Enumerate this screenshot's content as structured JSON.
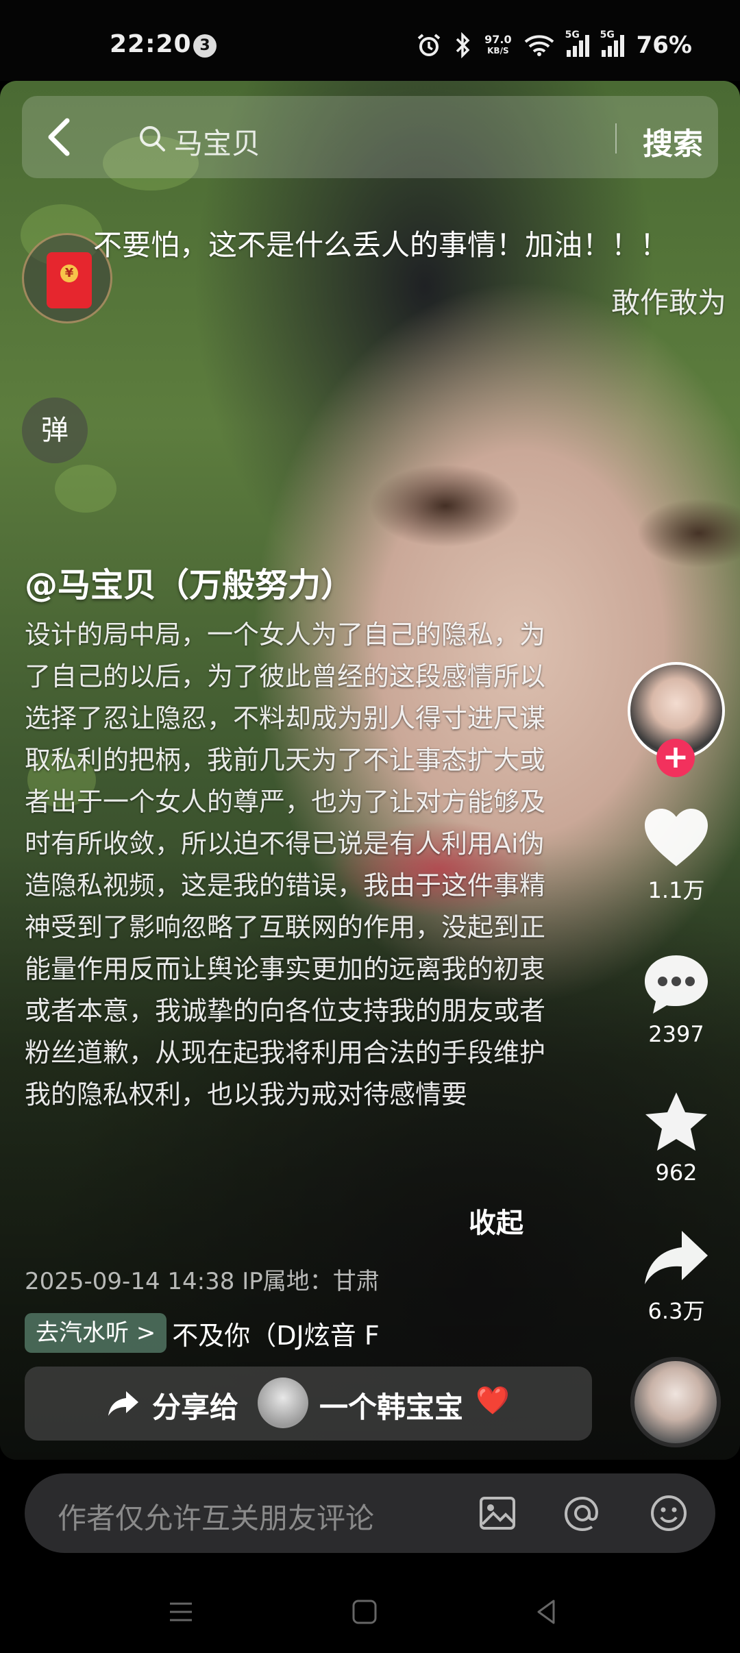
{
  "status_bar": {
    "time": "22:20",
    "notification_count": "3",
    "net_speed": "97.0",
    "net_unit": "KB/S",
    "signal1_label": "5G",
    "signal2_label": "5G",
    "battery": "76%"
  },
  "search": {
    "query": "马宝贝",
    "button": "搜索"
  },
  "danmu": {
    "line1": "不要怕，这不是什么丢人的事情！加油！！！",
    "line2": "敢作敢为"
  },
  "danmu_button": "弹",
  "post": {
    "author": "@马宝贝（万般努力）",
    "description": "设计的局中局，一个女人为了自己的隐私，为了自己的以后，为了彼此曾经的这段感情所以选择了忍让隐忍，不料却成为别人得寸进尺谋取私利的把柄，我前几天为了不让事态扩大或者出于一个女人的尊严，也为了让对方能够及时有所收敛，所以迫不得已说是有人利用Ai伪造隐私视频，这是我的错误，我由于这件事精神受到了影响忽略了互联网的作用，没起到正能量作用反而让舆论事实更加的远离我的初衷或者本意，我诚挚的向各位支持我的朋友或者粉丝道歉，从现在起我将利用合法的手段维护我的隐私权利，也以我为戒对待感情要",
    "collapse": "收起",
    "meta": "2025-09-14 14:38  IP属地：甘肃",
    "music_tag": "去汽水听 >",
    "music_name": "不及你（DJ炫音 F"
  },
  "share": {
    "label": "分享给",
    "target": "一个韩宝宝",
    "emoji": "❤️"
  },
  "actions": {
    "follow": "+",
    "likes": "1.1万",
    "comments": "2397",
    "favorites": "962",
    "shares": "6.3万"
  },
  "comment_bar": {
    "placeholder": "作者仅允许互关朋友评论"
  }
}
